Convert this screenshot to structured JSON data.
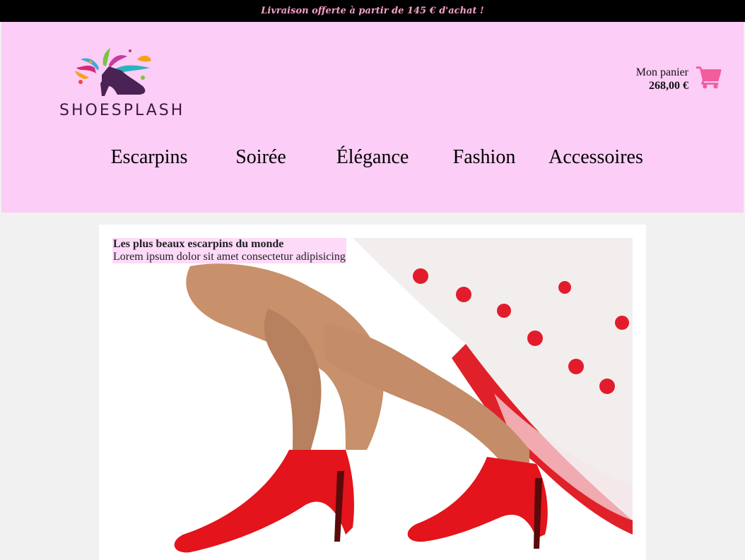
{
  "topbar": {
    "text": "Livraison offerte à partir de 145 € d'achat !"
  },
  "logo": {
    "text": "SHOESPLASH",
    "icon": "shoe-splash-logo-icon"
  },
  "cart": {
    "label": "Mon panier",
    "amount": "268,00 €",
    "icon": "shopping-cart-icon"
  },
  "nav": {
    "items": [
      "Escarpins",
      "Soirée",
      "Élégance",
      "Fashion",
      "Accessoires"
    ]
  },
  "hero": {
    "title": "Les plus beaux escarpins du monde",
    "subtitle": "Lorem ipsum dolor sit amet consectetur adipisicing"
  },
  "colors": {
    "header_bg": "#fccdf6",
    "topbar_bg": "#000000",
    "topbar_text": "#f7a0c8",
    "cart_icon": "#f15d9d",
    "page_bg": "#f1f1f1"
  }
}
